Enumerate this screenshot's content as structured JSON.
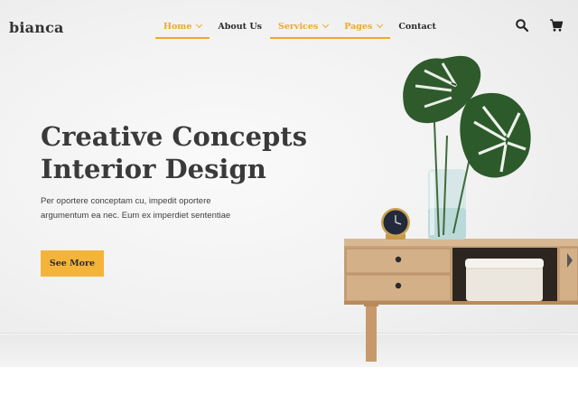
{
  "brand": {
    "name": "bianca"
  },
  "nav": {
    "items": [
      {
        "label": "Home",
        "dropdown": true,
        "accent": true,
        "underline": true
      },
      {
        "label": "About Us",
        "dropdown": false,
        "accent": false,
        "underline": false
      },
      {
        "label": "Services",
        "dropdown": true,
        "accent": true,
        "underline": true
      },
      {
        "label": "Pages",
        "dropdown": true,
        "accent": true,
        "underline": true
      },
      {
        "label": "Contact",
        "dropdown": false,
        "accent": false,
        "underline": false
      }
    ]
  },
  "header_icons": [
    "search-icon",
    "shopping-cart-icon"
  ],
  "hero": {
    "title_line1": "Creative Concepts",
    "title_line2": "Interior Design",
    "description": "Per oportere conceptam cu, impedit oportere argumentum ea nec. Eum ex imperdiet sententiae",
    "cta_label": "See More"
  },
  "colors": {
    "accent": "#f0a928",
    "button": "#f4b43a",
    "text_dark": "#3a3a3a",
    "background": "#f1f1f1"
  }
}
